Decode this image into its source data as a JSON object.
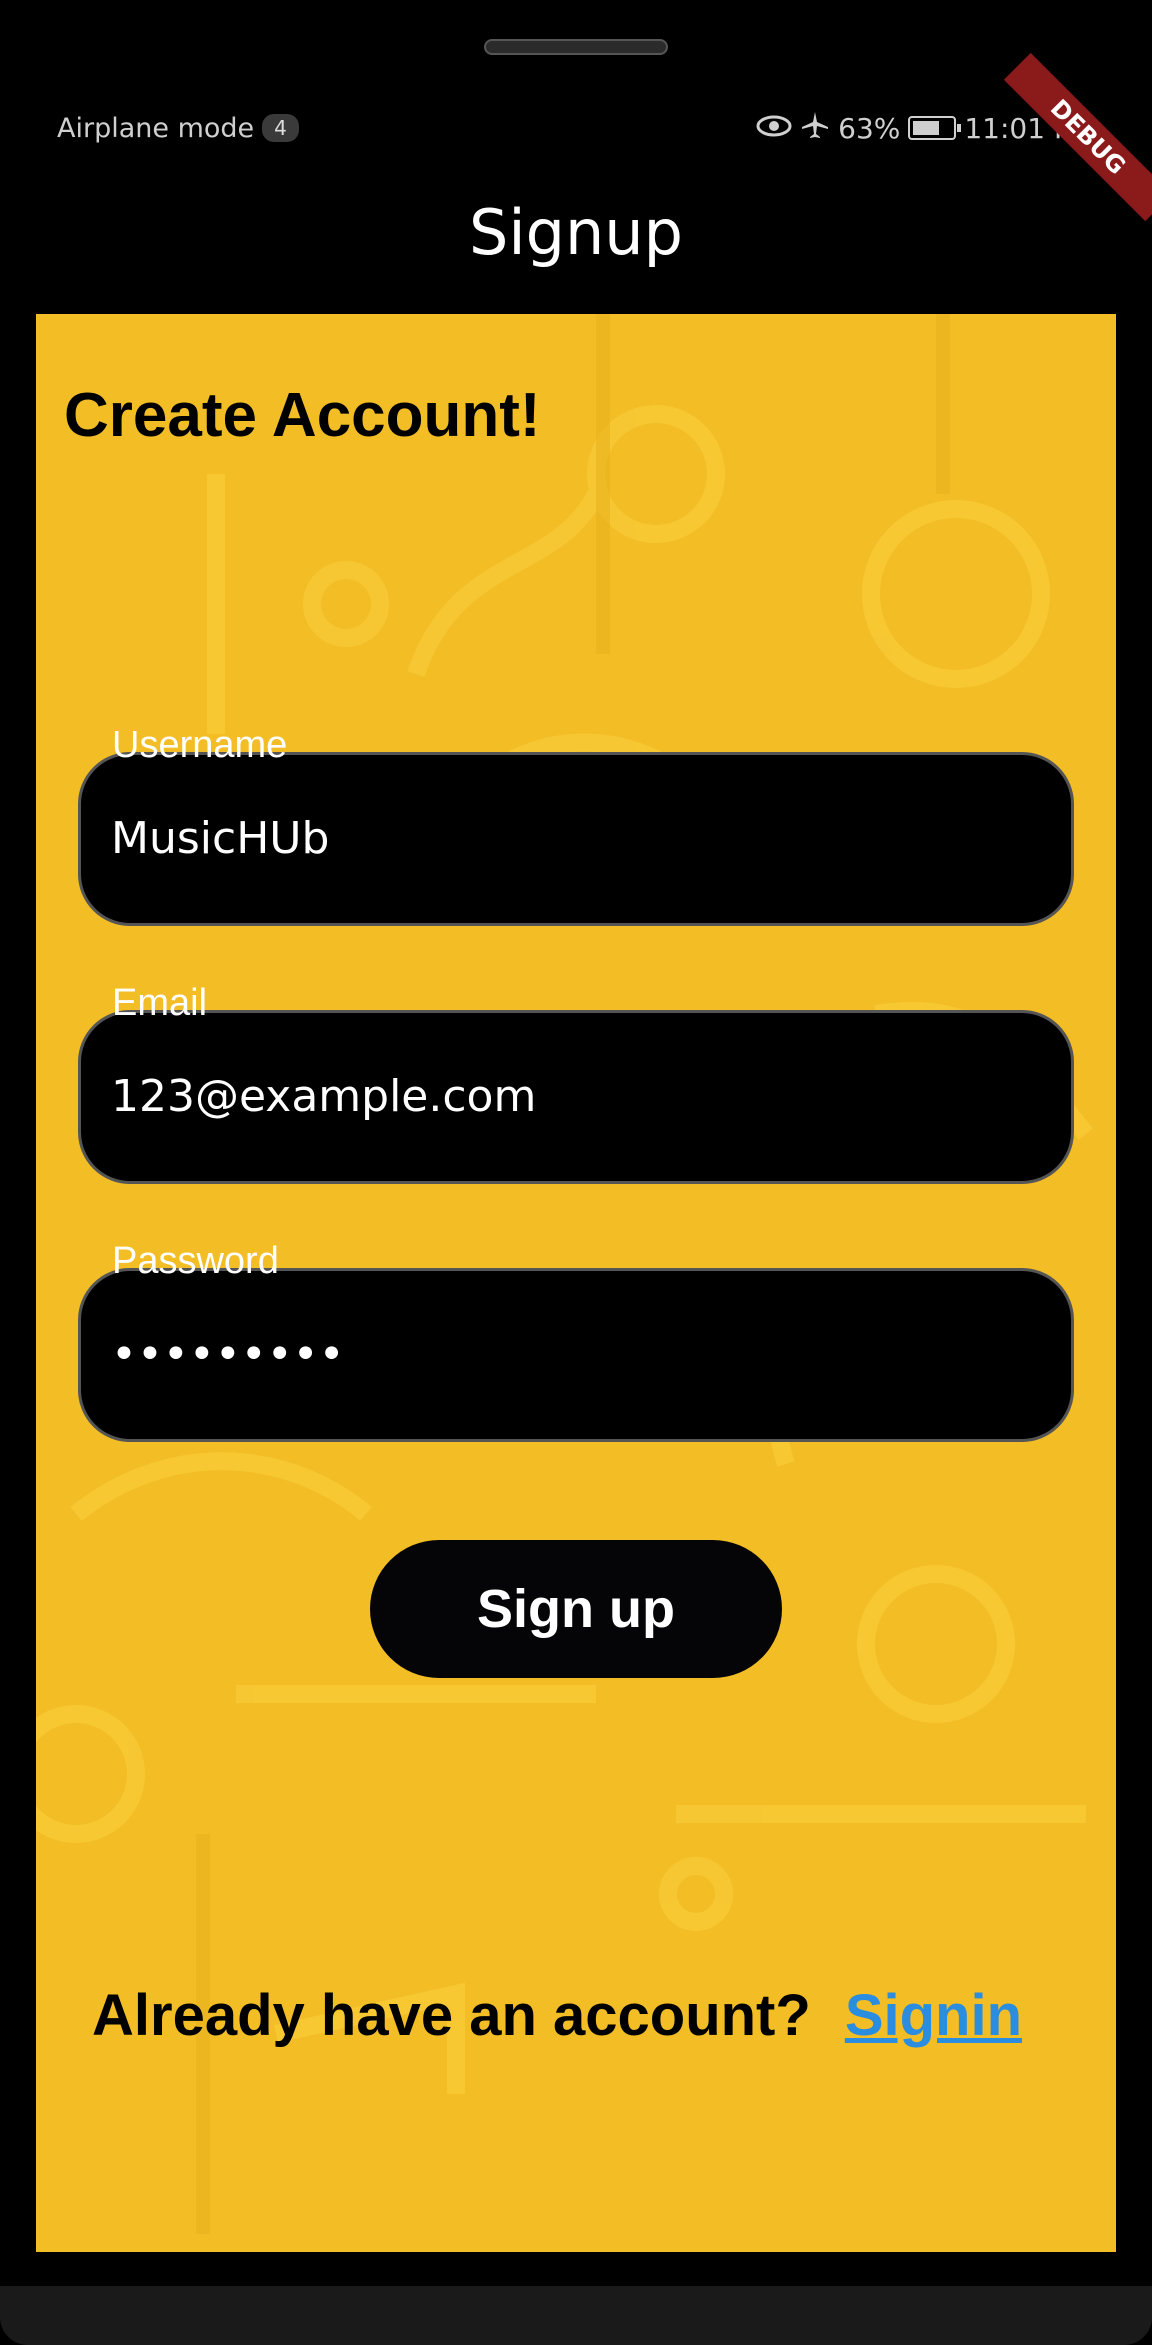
{
  "status_bar": {
    "airplane_label": "Airplane mode",
    "airplane_badge": "4",
    "battery_percent": "63%",
    "time": "11:01 PM"
  },
  "debug_banner": "DEBUG",
  "app_bar": {
    "title": "Signup"
  },
  "form": {
    "heading": "Create Account!",
    "username": {
      "label": "Username",
      "value": "MusicHUb"
    },
    "email": {
      "label": "Email",
      "value": "123@example.com"
    },
    "password": {
      "label": "Password",
      "value": "•••••••••"
    },
    "submit_label": "Sign up"
  },
  "footer": {
    "prompt": "Already have an account?",
    "link_label": "Signin"
  },
  "colors": {
    "background": "#f2bd25",
    "field": "#000000",
    "link": "#2a8de0",
    "debug": "#8b1a1a"
  },
  "icons": [
    "eye-icon",
    "airplane-icon",
    "battery-icon"
  ]
}
